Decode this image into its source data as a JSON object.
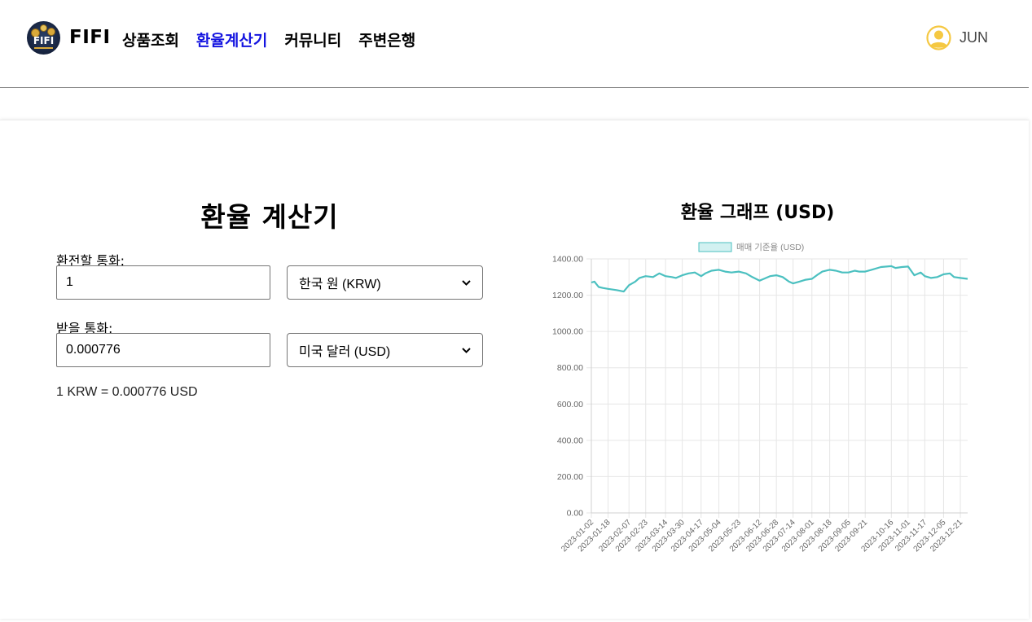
{
  "header": {
    "logo_text": "FIFI",
    "brand": "FIFI",
    "nav": [
      {
        "label": "상품조회",
        "active": false
      },
      {
        "label": "환율계산기",
        "active": true
      },
      {
        "label": "커뮤니티",
        "active": false
      },
      {
        "label": "주변은행",
        "active": false
      }
    ],
    "user": {
      "name": "JUN",
      "icon": "user-avatar-icon",
      "icon_color": "#f5c842"
    },
    "active_color": "#1414e0"
  },
  "calculator": {
    "title": "환율 계산기",
    "from_label": "환전할 통화:",
    "from_value": "1",
    "from_currency": "한국 원 (KRW)",
    "to_label": "받을 통화:",
    "to_value": "0.000776",
    "to_currency": "미국 달러 (USD)",
    "result": "1 KRW = 0.000776 USD"
  },
  "graph": {
    "title": "환율 그래프 (USD)"
  },
  "chart_data": {
    "type": "line",
    "title": "",
    "legend": {
      "label": "매매 기준율 (USD)",
      "position": "top"
    },
    "ylim": [
      0,
      1400
    ],
    "yticks": [
      "0.00",
      "200.00",
      "400.00",
      "600.00",
      "800.00",
      "1000.00",
      "1200.00",
      "1400.00"
    ],
    "xticks": [
      "2023-01-02",
      "2023-01-18",
      "2023-02-07",
      "2023-02-23",
      "2023-03-14",
      "2023-03-30",
      "2023-04-17",
      "2023-05-04",
      "2023-05-23",
      "2023-06-12",
      "2023-06-28",
      "2023-07-14",
      "2023-08-01",
      "2023-08-18",
      "2023-09-05",
      "2023-09-21",
      "2023-10-16",
      "2023-11-01",
      "2023-11-17",
      "2023-12-05",
      "2023-12-21"
    ],
    "grid": true,
    "line_color": "#4bc0c0",
    "fill_color": "#d2f1f1",
    "series": [
      {
        "name": "매매 기준율 (USD)",
        "x": [
          "2023-01-02",
          "2023-01-05",
          "2023-01-09",
          "2023-01-13",
          "2023-01-18",
          "2023-01-26",
          "2023-02-02",
          "2023-02-07",
          "2023-02-13",
          "2023-02-17",
          "2023-02-23",
          "2023-03-02",
          "2023-03-08",
          "2023-03-14",
          "2023-03-20",
          "2023-03-24",
          "2023-03-30",
          "2023-04-05",
          "2023-04-11",
          "2023-04-17",
          "2023-04-21",
          "2023-04-27",
          "2023-05-04",
          "2023-05-10",
          "2023-05-16",
          "2023-05-23",
          "2023-05-30",
          "2023-06-05",
          "2023-06-12",
          "2023-06-16",
          "2023-06-22",
          "2023-06-28",
          "2023-07-04",
          "2023-07-10",
          "2023-07-14",
          "2023-07-20",
          "2023-07-26",
          "2023-08-01",
          "2023-08-07",
          "2023-08-11",
          "2023-08-18",
          "2023-08-24",
          "2023-08-30",
          "2023-09-05",
          "2023-09-11",
          "2023-09-15",
          "2023-09-21",
          "2023-09-27",
          "2023-10-06",
          "2023-10-16",
          "2023-10-20",
          "2023-10-26",
          "2023-11-01",
          "2023-11-07",
          "2023-11-13",
          "2023-11-17",
          "2023-11-23",
          "2023-11-29",
          "2023-12-05",
          "2023-12-11",
          "2023-12-15",
          "2023-12-21",
          "2023-12-28"
        ],
        "values": [
          1270,
          1275,
          1245,
          1240,
          1235,
          1228,
          1220,
          1255,
          1275,
          1295,
          1305,
          1300,
          1320,
          1305,
          1300,
          1295,
          1310,
          1320,
          1325,
          1305,
          1320,
          1335,
          1340,
          1330,
          1325,
          1330,
          1320,
          1300,
          1280,
          1290,
          1305,
          1310,
          1300,
          1275,
          1265,
          1275,
          1285,
          1290,
          1315,
          1330,
          1340,
          1335,
          1325,
          1325,
          1335,
          1330,
          1330,
          1340,
          1355,
          1360,
          1350,
          1355,
          1358,
          1310,
          1325,
          1305,
          1295,
          1300,
          1315,
          1320,
          1300,
          1295,
          1290
        ]
      }
    ]
  }
}
